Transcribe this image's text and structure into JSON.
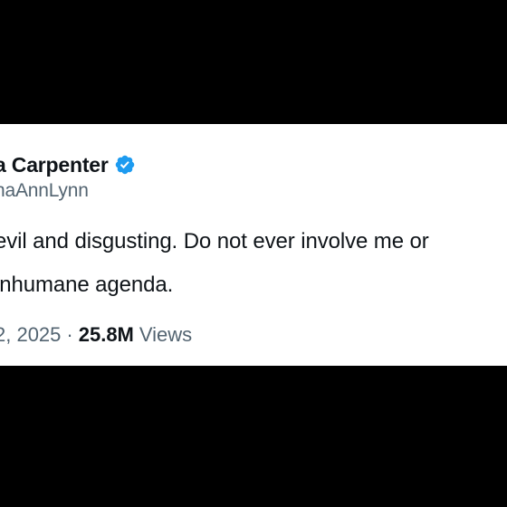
{
  "tweet": {
    "author": {
      "display_name": "a Carpenter",
      "handle": "naAnnLynn",
      "verified_color": "#1d9bf0",
      "verified_icon": "verified-badge-icon"
    },
    "text_lines": [
      "evil and disgusting. Do not ever involve me or",
      "inhumane agenda."
    ],
    "meta": {
      "date": "2, 2025",
      "separator": "·",
      "views_count": "25.8M",
      "views_label": "Views"
    }
  },
  "colors": {
    "background": "#000000",
    "card": "#ffffff",
    "primary_text": "#0f1419",
    "secondary_text": "#536471"
  }
}
